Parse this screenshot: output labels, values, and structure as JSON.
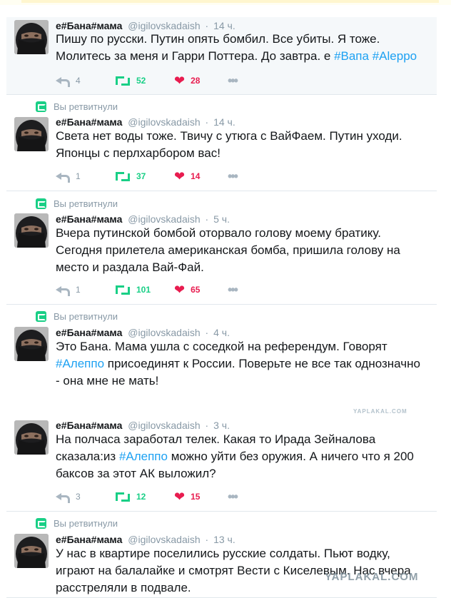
{
  "retweet_label": "Вы ретвитнули",
  "tweets": [
    {
      "retweeted": false,
      "name": "е#Бана#мама",
      "handle": "@igilovskadaish",
      "time": "14 ч.",
      "text_parts": [
        {
          "t": "Пишу по русски. Путин опять бомбил. Все убиты. Я тоже. Молитесь за меня и Гарри Поттера. До завтра. е "
        },
        {
          "t": "#Вапа",
          "hash": true
        },
        {
          "t": " "
        },
        {
          "t": "#Aleppo",
          "hash": true
        }
      ],
      "replies": "4",
      "retweets": "52",
      "likes": "28"
    },
    {
      "retweeted": true,
      "name": "е#Бана#мама",
      "handle": "@igilovskadaish",
      "time": "14 ч.",
      "text_parts": [
        {
          "t": "Света нет воды тоже. Твичу с утюга с ВайФаем. Путин уходи. Японцы с перлхарбором вас!"
        }
      ],
      "replies": "1",
      "retweets": "37",
      "likes": "14"
    },
    {
      "retweeted": true,
      "name": "е#Бана#мама",
      "handle": "@igilovskadaish",
      "time": "5 ч.",
      "text_parts": [
        {
          "t": "Вчера путинской бомбой оторвало голову моему братику. Сегодня прилетела американская бомба, пришила голову на место и раздала Вай-Фай."
        }
      ],
      "replies": "1",
      "retweets": "101",
      "likes": "65"
    },
    {
      "retweeted": true,
      "name": "е#Бана#мама",
      "handle": "@igilovskadaish",
      "time": "4 ч.",
      "text_parts": [
        {
          "t": "Это Бана. Мама ушла с соседкой на референдум. Говорят "
        },
        {
          "t": "#Алеппо",
          "hash": true
        },
        {
          "t": " присоединят к России. Поверьте не все так однозначно - она мне не мать!"
        }
      ],
      "replies": "",
      "retweets": "",
      "likes": ""
    },
    {
      "retweeted": false,
      "name": "е#Бана#мама",
      "handle": "@igilovskadaish",
      "time": "3 ч.",
      "text_parts": [
        {
          "t": "На полчаса заработал телек. Какая то Ирада Зейналова сказала:из "
        },
        {
          "t": "#Алеппо",
          "hash": true
        },
        {
          "t": " можно уйти без оружия. А ничего что я 200 баксов за этот АК выложил?"
        }
      ],
      "replies": "3",
      "retweets": "12",
      "likes": "15"
    },
    {
      "retweeted": true,
      "name": "е#Бана#мама",
      "handle": "@igilovskadaish",
      "time": "13 ч.",
      "text_parts": [
        {
          "t": "У нас в квартире поселились русские солдаты. Пьют водку, играют на балалайке и смотрят Вести с Киселевым. Нас вчера расстреляли в подвале."
        }
      ],
      "replies": "",
      "retweets": "",
      "likes": ""
    }
  ],
  "watermark": "YAPLAKAL.COM",
  "colors": {
    "accent_blue": "#1da1f2",
    "retweet_green": "#19cf86",
    "like_red": "#e81c4f",
    "muted": "#8899a6"
  }
}
